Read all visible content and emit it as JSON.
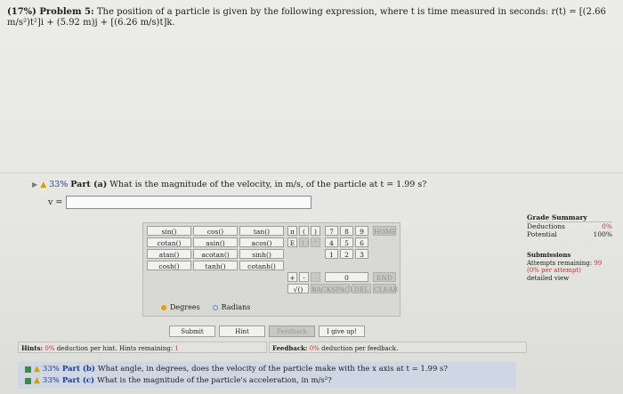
{
  "problem": {
    "label": "(17%) Problem 5:",
    "text": "The position of a particle is given by the following expression, where t is time measured in seconds: r(t) = [(2.66 m/s²)t²]i + (5.92 m)j + [(6.26 m/s)t]k."
  },
  "part_a": {
    "percent": "33%",
    "label": "Part (a)",
    "question": "What is the magnitude of the velocity, in m/s, of the particle at t = 1.99 s?",
    "answer_prefix": "v =",
    "answer_value": ""
  },
  "grade_summary": {
    "title": "Grade Summary",
    "deductions_label": "Deductions",
    "deductions_value": "0%",
    "potential_label": "Potential",
    "potential_value": "100%"
  },
  "submissions": {
    "title": "Submissions",
    "attempts_label": "Attempts remaining:",
    "attempts_value": "99",
    "per_attempt": "(0% per attempt)",
    "detailed_view": "detailed view"
  },
  "calculator": {
    "functions": [
      [
        "sin()",
        "cos()",
        "tan()"
      ],
      [
        "cotan()",
        "asin()",
        "acos()"
      ],
      [
        "atan()",
        "acotan()",
        "sinh()"
      ],
      [
        "cosh()",
        "tanh()",
        "cotanh()"
      ]
    ],
    "symbols": [
      "π",
      "(",
      ")",
      "E",
      "↑↑",
      "^",
      "+",
      "-",
      "·",
      "√()",
      "BACKSPACE",
      "DEL"
    ],
    "digits": [
      "7",
      "8",
      "9",
      "4",
      "5",
      "6",
      "1",
      "2",
      "3",
      "0"
    ],
    "side_buttons": [
      "HOME",
      "END",
      "CLEAR"
    ],
    "angle_modes": [
      "Degrees",
      "Radians"
    ],
    "selected_mode": "Degrees"
  },
  "actions": {
    "submit": "Submit",
    "hint": "Hint",
    "feedback": "Feedback",
    "give_up": "I give up!"
  },
  "hints": {
    "label": "Hints:",
    "deduction": "0%",
    "text": "deduction per hint. Hints remaining:",
    "remaining": "1"
  },
  "feedback": {
    "label": "Feedback:",
    "deduction": "0%",
    "text": "deduction per feedback."
  },
  "other_parts": [
    {
      "percent": "33%",
      "label": "Part (b)",
      "question": "What angle, in degrees, does the velocity of the particle make with the x axis at t = 1.99 s?"
    },
    {
      "percent": "33%",
      "label": "Part (c)",
      "question": "What is the magnitude of the particle's acceleration, in m/s²?"
    }
  ]
}
